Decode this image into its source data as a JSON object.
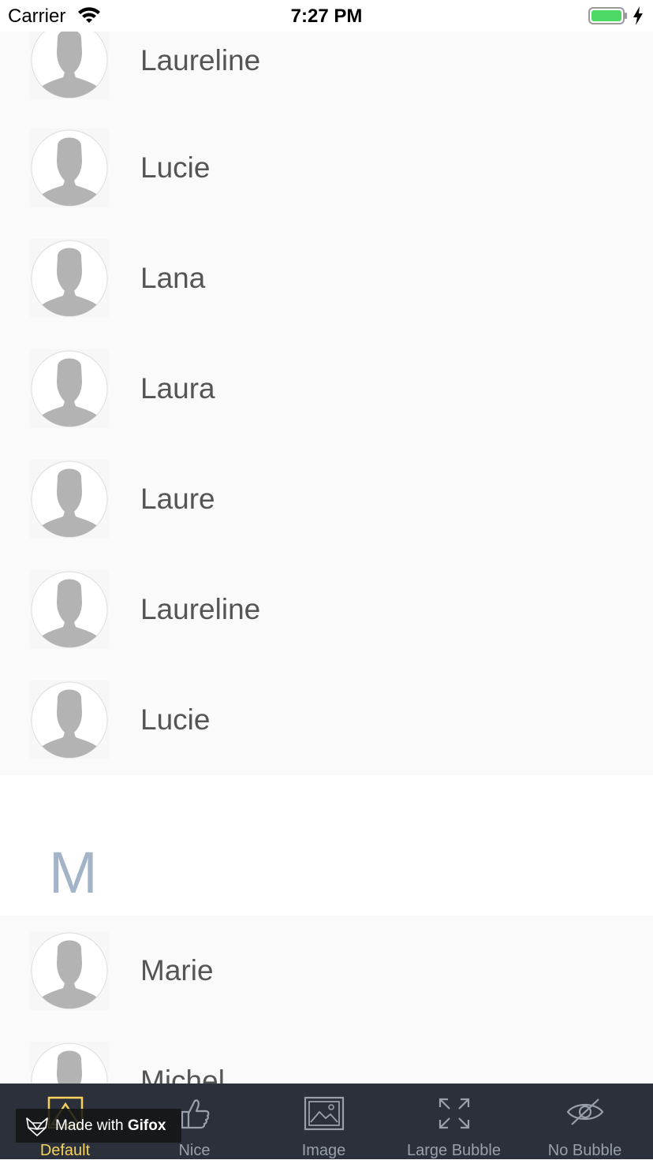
{
  "status_bar": {
    "carrier": "Carrier",
    "time": "7:27 PM",
    "battery_color": "#4cd964"
  },
  "list": {
    "group_l": [
      {
        "name": "Laureline",
        "avatar_icon": "person-silhouette-icon"
      },
      {
        "name": "Lucie",
        "avatar_icon": "person-silhouette-icon"
      },
      {
        "name": "Lana",
        "avatar_icon": "person-silhouette-icon"
      },
      {
        "name": "Laura",
        "avatar_icon": "person-silhouette-icon"
      },
      {
        "name": "Laure",
        "avatar_icon": "person-silhouette-icon"
      },
      {
        "name": "Laureline",
        "avatar_icon": "person-silhouette-icon"
      },
      {
        "name": "Lucie",
        "avatar_icon": "person-silhouette-icon"
      }
    ],
    "section_m": {
      "letter": "M",
      "letter_color": "#a3b4c8",
      "rows": [
        {
          "name": "Marie",
          "avatar_icon": "person-silhouette-icon"
        },
        {
          "name": "Michel",
          "avatar_icon": "person-silhouette-icon"
        }
      ]
    }
  },
  "tab_bar": {
    "active_color": "#f5d35b",
    "inactive_color": "#9aa0ab",
    "tabs": [
      {
        "label": "Default",
        "icon": "picture-frame-icon",
        "active": true
      },
      {
        "label": "Nice",
        "icon": "thumbs-up-icon",
        "active": false
      },
      {
        "label": "Image",
        "icon": "image-icon",
        "active": false
      },
      {
        "label": "Large Bubble",
        "icon": "expand-arrows-icon",
        "active": false
      },
      {
        "label": "No Bubble",
        "icon": "eye-slash-icon",
        "active": false
      }
    ]
  },
  "watermark": {
    "prefix": "Made with ",
    "brand": "Gifox"
  }
}
